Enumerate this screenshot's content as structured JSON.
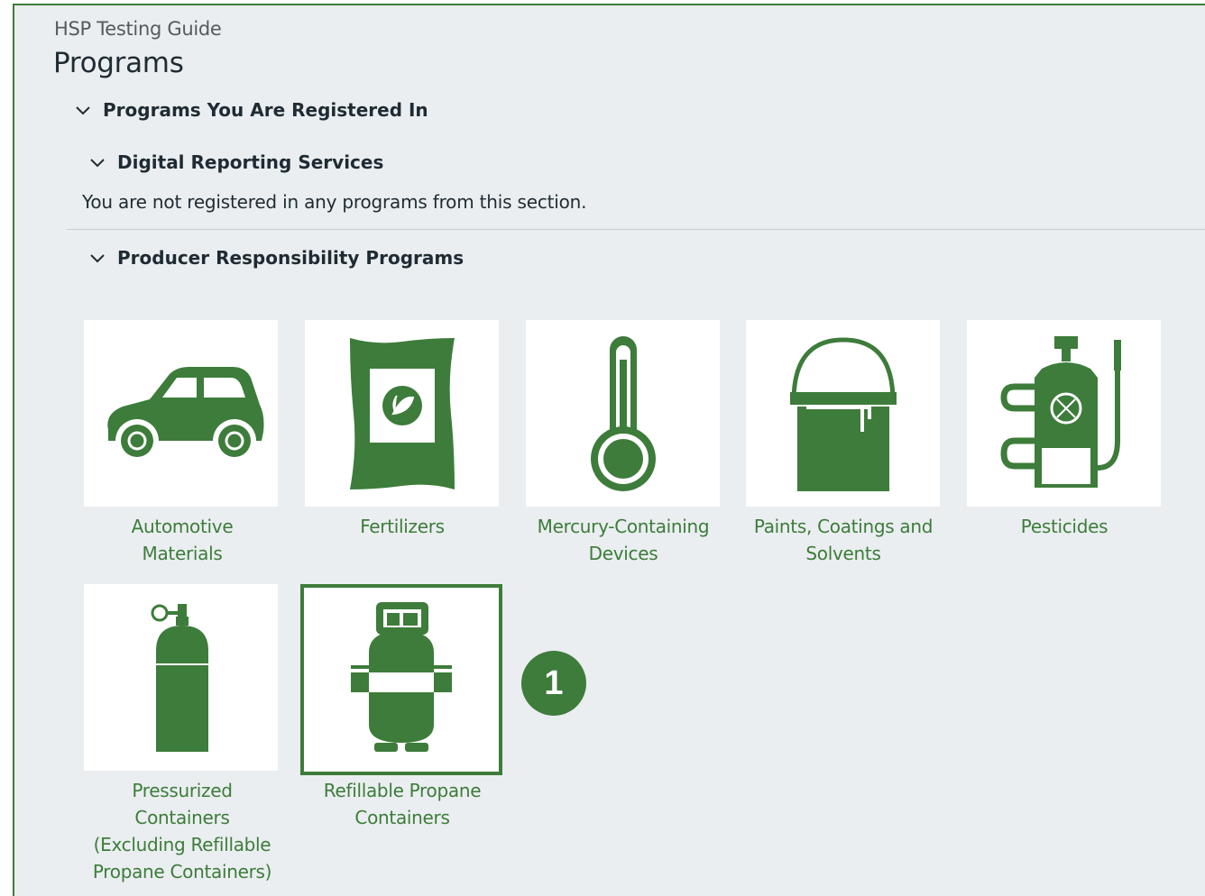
{
  "header": {
    "subtitle": "HSP Testing Guide",
    "title": "Programs"
  },
  "sections": {
    "registered": {
      "label": "Programs You Are Registered In",
      "icon": "chevron-down-icon"
    },
    "digital": {
      "label": "Digital Reporting Services",
      "icon": "chevron-down-icon",
      "notice": "You are not registered in any programs from this section."
    },
    "producer": {
      "label": "Producer Responsibility Programs",
      "icon": "chevron-down-icon"
    }
  },
  "programs": [
    {
      "label_lines": [
        "Automotive",
        "Materials"
      ],
      "icon": "car-icon"
    },
    {
      "label_lines": [
        "Fertilizers"
      ],
      "icon": "fertilizer-bag-icon"
    },
    {
      "label_lines": [
        "Mercury-Containing",
        "Devices"
      ],
      "icon": "thermometer-icon"
    },
    {
      "label_lines": [
        "Paints, Coatings and",
        "Solvents"
      ],
      "icon": "paint-can-icon"
    },
    {
      "label_lines": [
        "Pesticides"
      ],
      "icon": "pesticide-sprayer-icon"
    },
    {
      "label_lines": [
        "Pressurized",
        "Containers",
        "(Excluding Refillable",
        "Propane Containers)"
      ],
      "icon": "gas-cylinder-icon"
    },
    {
      "label_lines": [
        "Refillable Propane",
        "Containers"
      ],
      "icon": "propane-tank-icon",
      "selected": true
    }
  ],
  "callout": {
    "step": "1"
  },
  "colors": {
    "accent": "#3d7c3a",
    "background": "#eaeef0",
    "text": "#1f2b33"
  }
}
